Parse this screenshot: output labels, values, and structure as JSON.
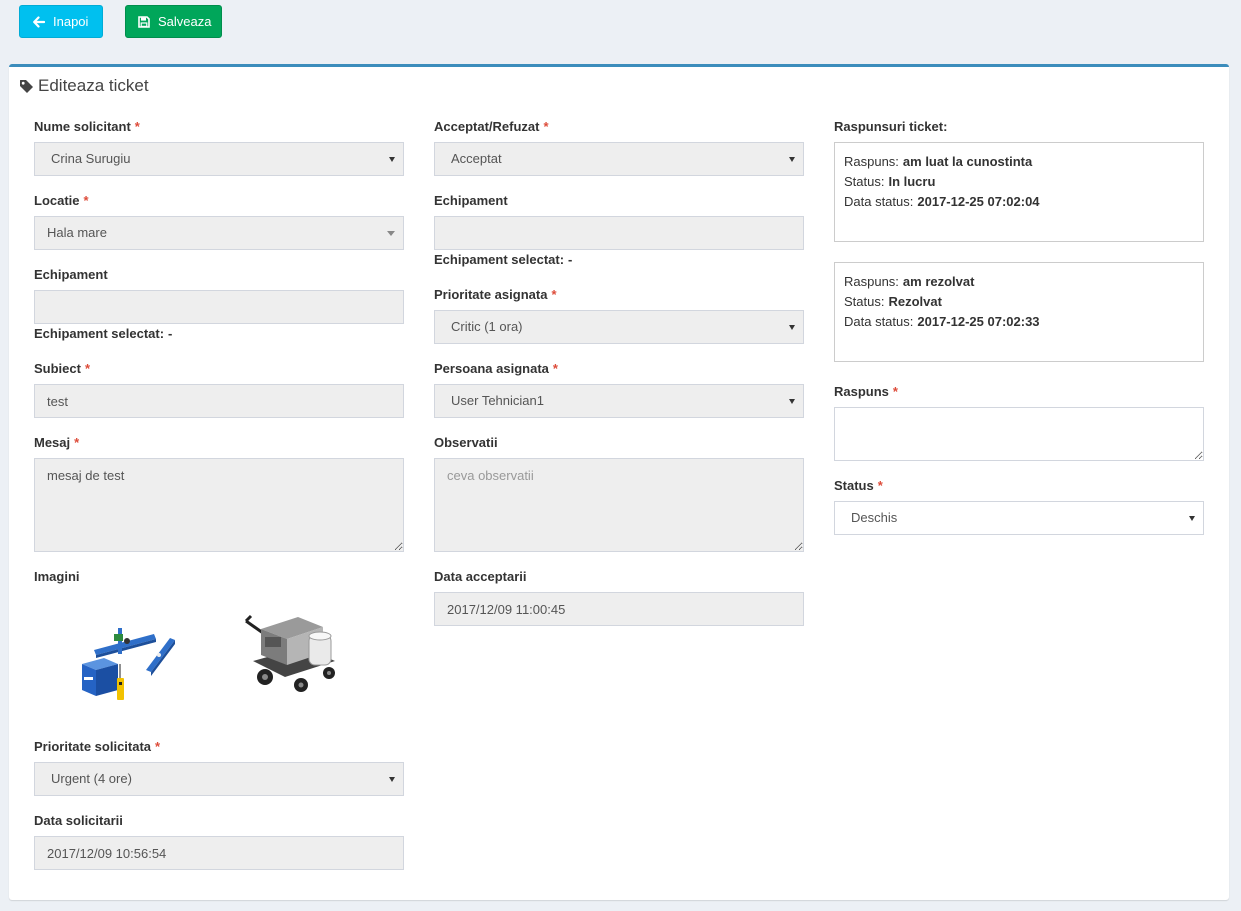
{
  "toolbar": {
    "back_label": "Inapoi",
    "back_icon": "arrow-left-icon",
    "save_label": "Salveaza",
    "save_icon": "floppy-disk-icon"
  },
  "box": {
    "title": "Editeaza ticket",
    "icon": "tag-icon"
  },
  "required_mark": "*",
  "colors": {
    "back_button": "#00c0ef",
    "save_button": "#00a65a",
    "box_border": "#3c8dbc",
    "required": "#dd4b39"
  },
  "left": {
    "nume_solicitant": {
      "label": "Nume solicitant",
      "value": "Crina Surugiu"
    },
    "locatie": {
      "label": "Locatie",
      "value": "Hala mare"
    },
    "echipament": {
      "label": "Echipament"
    },
    "echipament_selectat": {
      "label": "Echipament selectat:",
      "value": "-"
    },
    "subiect": {
      "label": "Subiect",
      "value": "test"
    },
    "mesaj": {
      "label": "Mesaj",
      "value": "mesaj de test"
    },
    "imagini": {
      "label": "Imagini"
    },
    "prioritate_solicitata": {
      "label": "Prioritate solicitata",
      "value": "Urgent (4 ore)"
    },
    "data_solicitarii": {
      "label": "Data solicitarii",
      "value": "2017/12/09 10:56:54"
    }
  },
  "middle": {
    "acceptat_refuzat": {
      "label": "Acceptat/Refuzat",
      "value": "Acceptat"
    },
    "echipament": {
      "label": "Echipament"
    },
    "echipament_selectat": {
      "label": "Echipament selectat:",
      "value": "-"
    },
    "prioritate_asignata": {
      "label": "Prioritate asignata",
      "value": "Critic (1 ora)"
    },
    "persoana_asignata": {
      "label": "Persoana asignata",
      "value": "User Tehnician1"
    },
    "observatii": {
      "label": "Observatii",
      "placeholder": "ceva observatii"
    },
    "data_acceptarii": {
      "label": "Data acceptarii",
      "value": "2017/12/09 11:00:45"
    }
  },
  "right": {
    "raspunsuri": {
      "title": "Raspunsuri ticket:",
      "labels": {
        "raspuns": "Raspuns:",
        "status": "Status:",
        "data_status": "Data status:"
      },
      "items": [
        {
          "raspuns": "am luat la cunostinta",
          "status": "In lucru",
          "data_status": "2017-12-25 07:02:04"
        },
        {
          "raspuns": "am rezolvat",
          "status": "Rezolvat",
          "data_status": "2017-12-25 07:02:33"
        }
      ]
    },
    "raspuns": {
      "label": "Raspuns"
    },
    "status": {
      "label": "Status",
      "value": "Deschis"
    }
  }
}
